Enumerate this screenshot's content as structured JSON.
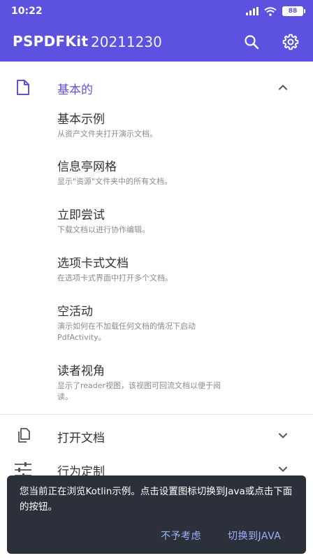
{
  "status": {
    "time": "10:22",
    "battery": "88"
  },
  "appbar": {
    "title": "PSPDFKit",
    "version": "20211230"
  },
  "sections": {
    "basic": {
      "label": "基本的",
      "items": [
        {
          "title": "基本示例",
          "subtitle": "从资产文件夹打开演示文档。"
        },
        {
          "title": "信息亭网格",
          "subtitle": "显示\"资源\"文件夹中的所有文档。"
        },
        {
          "title": "立即尝试",
          "subtitle": "下载文档以进行协作编辑。"
        },
        {
          "title": "选项卡式文档",
          "subtitle": "在选项卡式界面中打开多个文档。"
        },
        {
          "title": "空活动",
          "subtitle": "演示如何在不加载任何文档的情况下启动",
          "subtitle2": "PdfActivity。"
        },
        {
          "title": "读者视角",
          "subtitle": "显示了reader视图，该视图可回流文档以便于阅",
          "subtitle2": "读。"
        }
      ]
    },
    "open": {
      "label": "打开文档"
    },
    "behavior": {
      "label": "行为定制"
    }
  },
  "snackbar": {
    "message": "您当前正在浏览Kotlin示例。点击设置图标切换到Java或点击下面的按钮。",
    "dismiss": "不予考虑",
    "switch": "切换到JAVA"
  },
  "colors": {
    "primary": "#5D52E0",
    "snackbar_bg": "#2b303a",
    "action": "#9fb0ff"
  }
}
